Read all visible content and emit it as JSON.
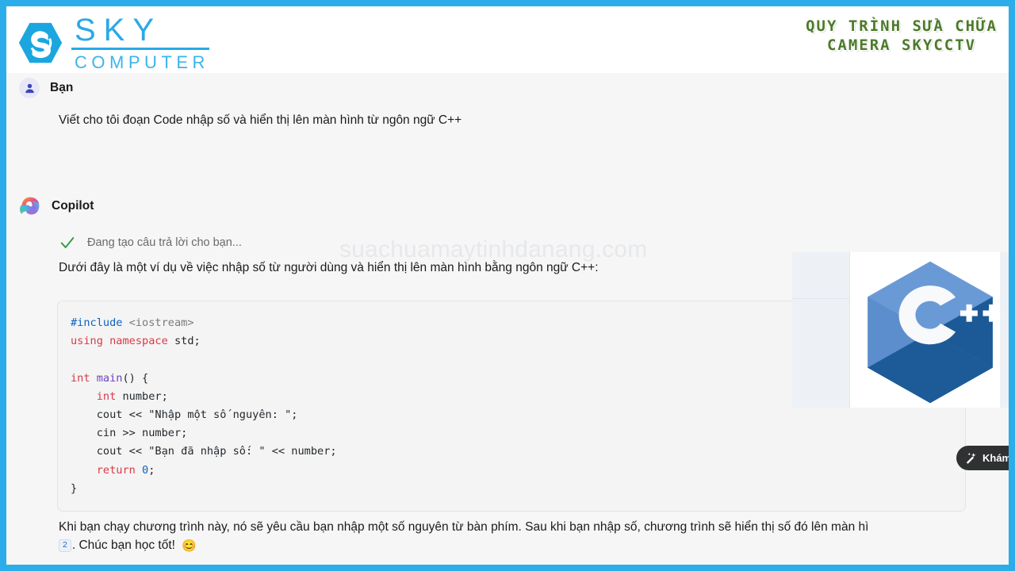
{
  "header": {
    "brand_sky": "SKY",
    "brand_computer": "COMPUTER",
    "logo_icon": "sky-hexagon-logo",
    "banner_line1": "QUY TRÌNH SỬA CHỮA",
    "banner_line2": "CAMERA SKYCCTV",
    "banner_color": "#4d7a2a"
  },
  "watermark": {
    "text": "suachuamaytinhdanang.com"
  },
  "user_message": {
    "author": "Bạn",
    "avatar_icon": "user-avatar-icon",
    "text": "Viết cho tôi đoạn Code nhập số và hiển thị lên màn hình từ ngôn ngữ C++"
  },
  "assistant_message": {
    "author": "Copilot",
    "logo_icon": "copilot-logo-icon",
    "status_icon": "check-icon",
    "status_text": "Đang tạo câu trả lời cho bạn...",
    "intro": "Dưới đây là một ví dụ về việc nhập số từ người dùng và hiển thị lên màn hình bằng ngôn ngữ C++:",
    "closing_line1": "Khi bạn chạy chương trình này, nó sẽ yêu cầu bạn nhập một số nguyên từ bàn phím. Sau khi bạn nhập số, chương trình sẽ hiển thị số đó lên màn hì",
    "citation": "2",
    "closing_line2": ". Chúc bạn học tốt!",
    "emoji": "😊"
  },
  "code_block": {
    "language": "cpp",
    "lines": [
      [
        {
          "t": "#include",
          "c": "tok-pre"
        },
        {
          "t": " ",
          "c": "tok-pln"
        },
        {
          "t": "<iostream>",
          "c": "tok-inc"
        }
      ],
      [
        {
          "t": "using",
          "c": "tok-kw"
        },
        {
          "t": " ",
          "c": "tok-pln"
        },
        {
          "t": "namespace",
          "c": "tok-kw"
        },
        {
          "t": " std;",
          "c": "tok-pln"
        }
      ],
      [],
      [
        {
          "t": "int",
          "c": "tok-kw"
        },
        {
          "t": " ",
          "c": "tok-pln"
        },
        {
          "t": "main",
          "c": "tok-fn"
        },
        {
          "t": "() {",
          "c": "tok-pln"
        }
      ],
      [
        {
          "t": "    ",
          "c": "tok-pln"
        },
        {
          "t": "int",
          "c": "tok-kw"
        },
        {
          "t": " number;",
          "c": "tok-pln"
        }
      ],
      [
        {
          "t": "    cout << ",
          "c": "tok-pln"
        },
        {
          "t": "\"Nhập một số nguyên: \"",
          "c": "tok-str"
        },
        {
          "t": ";",
          "c": "tok-pln"
        }
      ],
      [
        {
          "t": "    cin >> number;",
          "c": "tok-pln"
        }
      ],
      [
        {
          "t": "    cout << ",
          "c": "tok-pln"
        },
        {
          "t": "\"Bạn đã nhập số: \"",
          "c": "tok-str"
        },
        {
          "t": " << number;",
          "c": "tok-pln"
        }
      ],
      [
        {
          "t": "    ",
          "c": "tok-pln"
        },
        {
          "t": "return",
          "c": "tok-kw"
        },
        {
          "t": " ",
          "c": "tok-pln"
        },
        {
          "t": "0",
          "c": "tok-num"
        },
        {
          "t": ";",
          "c": "tok-pln"
        }
      ],
      [
        {
          "t": "}",
          "c": "tok-pln"
        }
      ]
    ]
  },
  "cpp_overlay": {
    "logo_icon": "cplusplus-logo-icon",
    "logo_text": "C++",
    "explore_label": "Khám",
    "explore_icon": "magic-wand-icon"
  }
}
